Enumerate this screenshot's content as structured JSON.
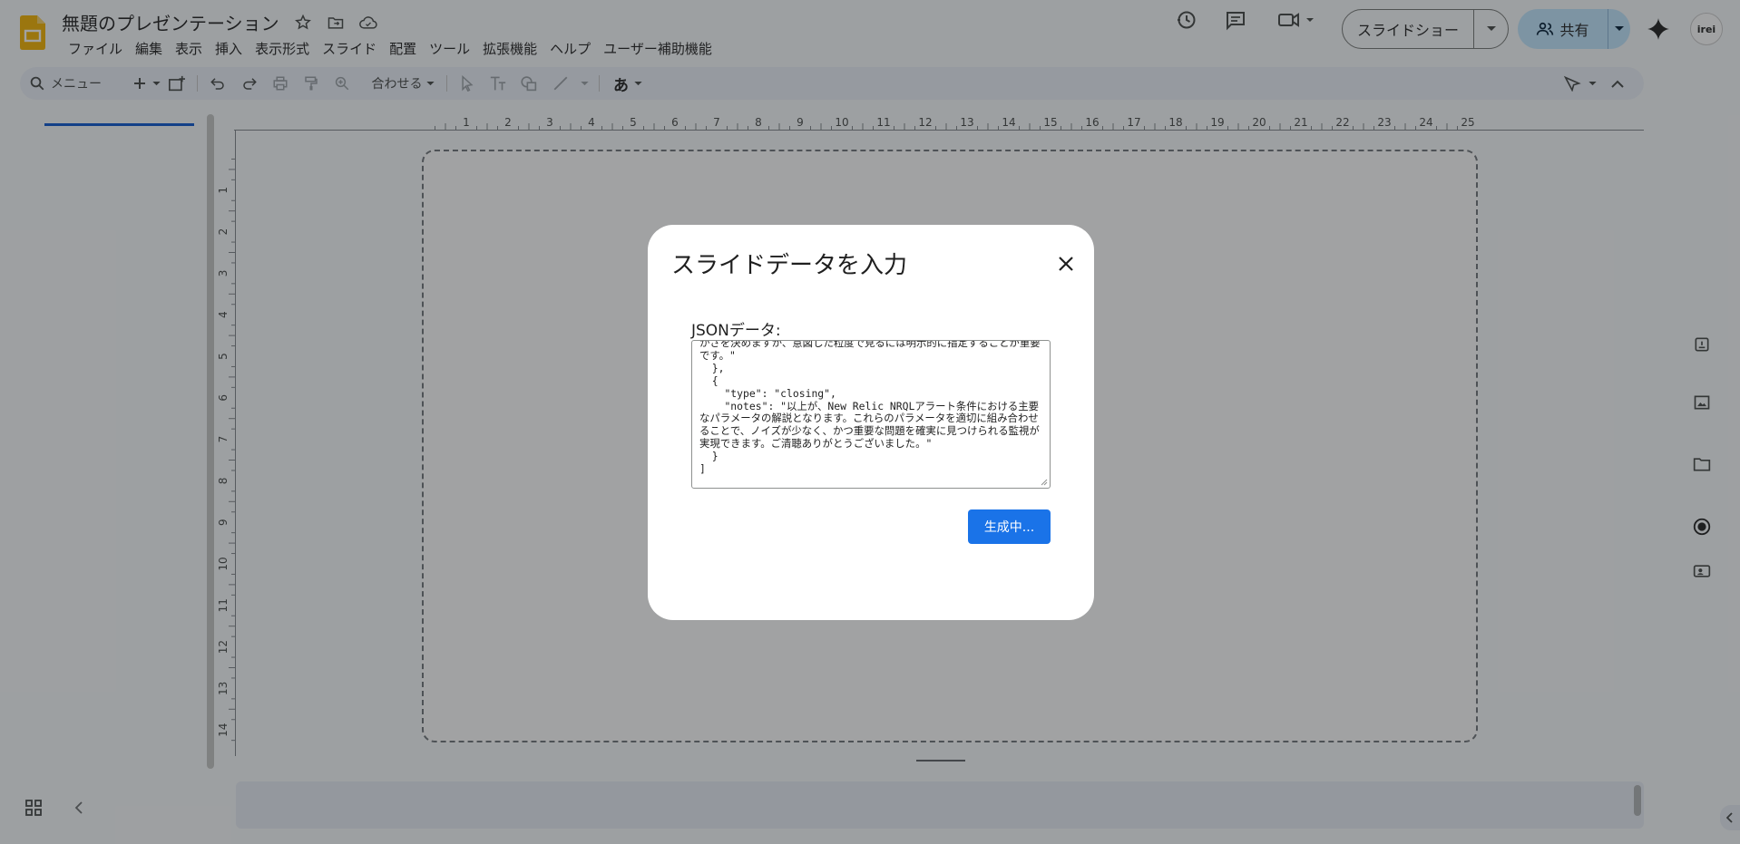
{
  "app": {
    "doc_title": "無題のプレゼンテーション",
    "icons": [
      "star-icon",
      "move-to-folder-icon",
      "cloud-status-icon"
    ],
    "menu": [
      "ファイル",
      "編集",
      "表示",
      "挿入",
      "表示形式",
      "スライド",
      "配置",
      "ツール",
      "拡張機能",
      "ヘルプ",
      "ユーザー補助機能"
    ]
  },
  "header_actions": {
    "slideshow_label": "スライドショー",
    "share_label": "共有",
    "avatar_text": "irei"
  },
  "toolbar": {
    "search_label": "メニュー",
    "zoom_label": "合わせる",
    "input_tools_label": "あ"
  },
  "rulers": {
    "horizontal": [
      "1",
      "2",
      "3",
      "4",
      "5",
      "6",
      "7",
      "8",
      "9",
      "10",
      "11",
      "12",
      "13",
      "14",
      "15",
      "16",
      "17",
      "18",
      "19",
      "20",
      "21",
      "22",
      "23",
      "24",
      "25"
    ],
    "vertical": [
      "1",
      "2",
      "3",
      "4",
      "5",
      "6",
      "7",
      "8",
      "9",
      "10",
      "11",
      "12",
      "13",
      "14"
    ]
  },
  "dialog": {
    "title": "スライドデータを入力",
    "field_label": "JSONデータ:",
    "json_text": "かさを決めますが、意図した粒度で見るには明示的に指定することが重要です。\"\n  },\n  {\n    \"type\": \"closing\",\n    \"notes\": \"以上が、New Relic NRQLアラート条件における主要なパラメータの解説となります。これらのパラメータを適切に組み合わせることで、ノイズが少なく、かつ重要な問題を確実に見つけられる監視が実現できます。ご清聴ありがとうございました。\"\n  }\n]",
    "generate_label": "生成中..."
  },
  "colors": {
    "accent": "#1a73e8",
    "share_bg": "#c2e7ff",
    "logo": "#f4b400"
  }
}
